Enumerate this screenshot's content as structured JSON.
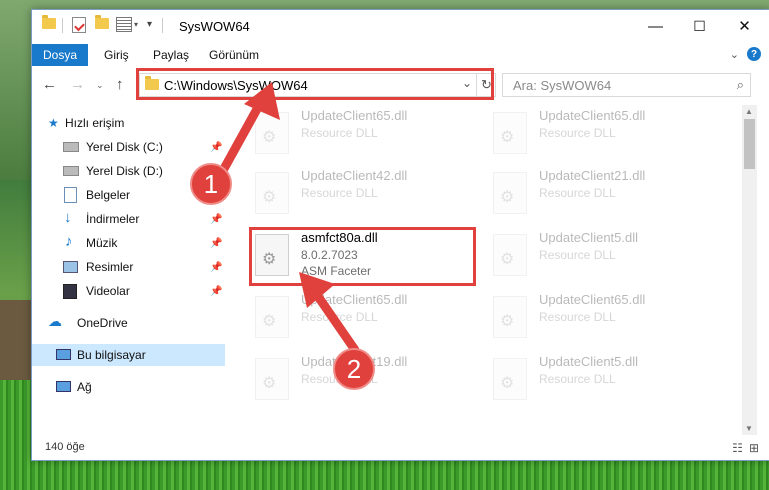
{
  "window": {
    "title": "SysWOW64",
    "controls": {
      "minimize": "—",
      "maximize": "☐",
      "close": "✕"
    }
  },
  "ribbon": {
    "file_tab": "Dosya",
    "tabs": [
      "Giriş",
      "Paylaş",
      "Görünüm"
    ],
    "help": "?"
  },
  "nav": {
    "address": "C:\\Windows\\SysWOW64",
    "search_placeholder": "Ara: SysWOW64"
  },
  "sidebar": {
    "items": [
      {
        "label": "Hızlı erişim",
        "icon": "star-icon"
      },
      {
        "label": "Yerel Disk (C:)",
        "icon": "drive-icon",
        "pinned": true
      },
      {
        "label": "Yerel Disk (D:)",
        "icon": "drive-icon"
      },
      {
        "label": "Belgeler",
        "icon": "documents-icon",
        "pinned": true
      },
      {
        "label": "İndirmeler",
        "icon": "download-icon",
        "pinned": true
      },
      {
        "label": "Müzik",
        "icon": "music-icon",
        "pinned": true
      },
      {
        "label": "Resimler",
        "icon": "pictures-icon",
        "pinned": true
      },
      {
        "label": "Videolar",
        "icon": "video-icon",
        "pinned": true
      },
      {
        "label": "OneDrive",
        "icon": "cloud-icon"
      },
      {
        "label": "Bu bilgisayar",
        "icon": "computer-icon",
        "selected": true
      },
      {
        "label": "Ağ",
        "icon": "network-icon"
      }
    ]
  },
  "files": [
    {
      "name": "UpdateClient65.dll",
      "type": "Resource DLL",
      "faded": true
    },
    {
      "name": "UpdateClient65.dll",
      "type": "Resource DLL",
      "faded": true
    },
    {
      "name": "UpdateClient42.dll",
      "type": "Resource DLL",
      "faded": true
    },
    {
      "name": "UpdateClient21.dll",
      "type": "Resource DLL",
      "faded": true
    },
    {
      "name": "asmfct80a.dll",
      "version": "8.0.2.7023",
      "company": "ASM Faceter",
      "faded": false
    },
    {
      "name": "UpdateClient5.dll",
      "type": "Resource DLL",
      "faded": true
    },
    {
      "name": "UpdateClient65.dll",
      "type": "Resource DLL",
      "faded": true
    },
    {
      "name": "UpdateClient65.dll",
      "type": "Resource DLL",
      "faded": true
    },
    {
      "name": "UpdateClient19.dll",
      "type": "Resource DLL",
      "faded": true
    },
    {
      "name": "UpdateClient5.dll",
      "type": "Resource DLL",
      "faded": true
    }
  ],
  "status": {
    "count": "140 öğe"
  },
  "annotations": {
    "step1": "1",
    "step2": "2",
    "color": "#e0413d"
  }
}
